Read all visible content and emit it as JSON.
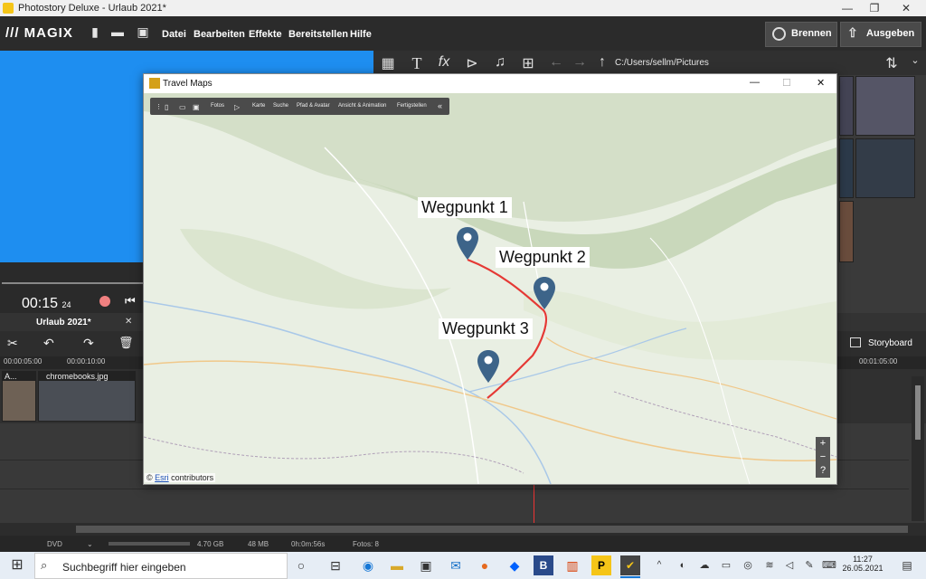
{
  "window": {
    "title": "Photostory Deluxe - Urlaub 2021*"
  },
  "menubar": {
    "logo": "MAGIX",
    "items": [
      "Datei",
      "Bearbeiten",
      "Effekte",
      "Bereitstellen",
      "Hilfe"
    ],
    "burn_label": "Brennen",
    "export_label": "Ausgeben"
  },
  "toolbar2": {
    "path": "C:/Users/sellm/Pictures"
  },
  "preview": {
    "time_main": "00:15",
    "time_frames": "24"
  },
  "timeline": {
    "project": "Urlaub 2021*",
    "storyboard_label": "Storyboard",
    "ruler": [
      "00:00:05:00",
      "00:00:10:00",
      "00:01:05:00"
    ],
    "clips": [
      "A...",
      "chromebooks.jpg"
    ]
  },
  "status": {
    "format": "DVD",
    "size1": "4.70 GB",
    "size2": "48 MB",
    "duration": "0h:0m:56s",
    "photos": "Fotos: 8"
  },
  "travelmaps": {
    "title": "Travel Maps",
    "toolbar": [
      "Fotos",
      "Karte",
      "Suche",
      "Pfad & Avatar",
      "Ansicht & Animation",
      "Fertigstellen"
    ],
    "waypoints": [
      "Wegpunkt 1",
      "Wegpunkt 2",
      "Wegpunkt 3"
    ],
    "attribution_prefix": "© ",
    "attribution_link": "Esri",
    "attribution_suffix": " contributors",
    "route_color": "#e53935",
    "pin_color": "#3d6489"
  },
  "taskbar": {
    "search_placeholder": "Suchbegriff hier eingeben",
    "time": "11:27",
    "date": "26.05.2021"
  }
}
